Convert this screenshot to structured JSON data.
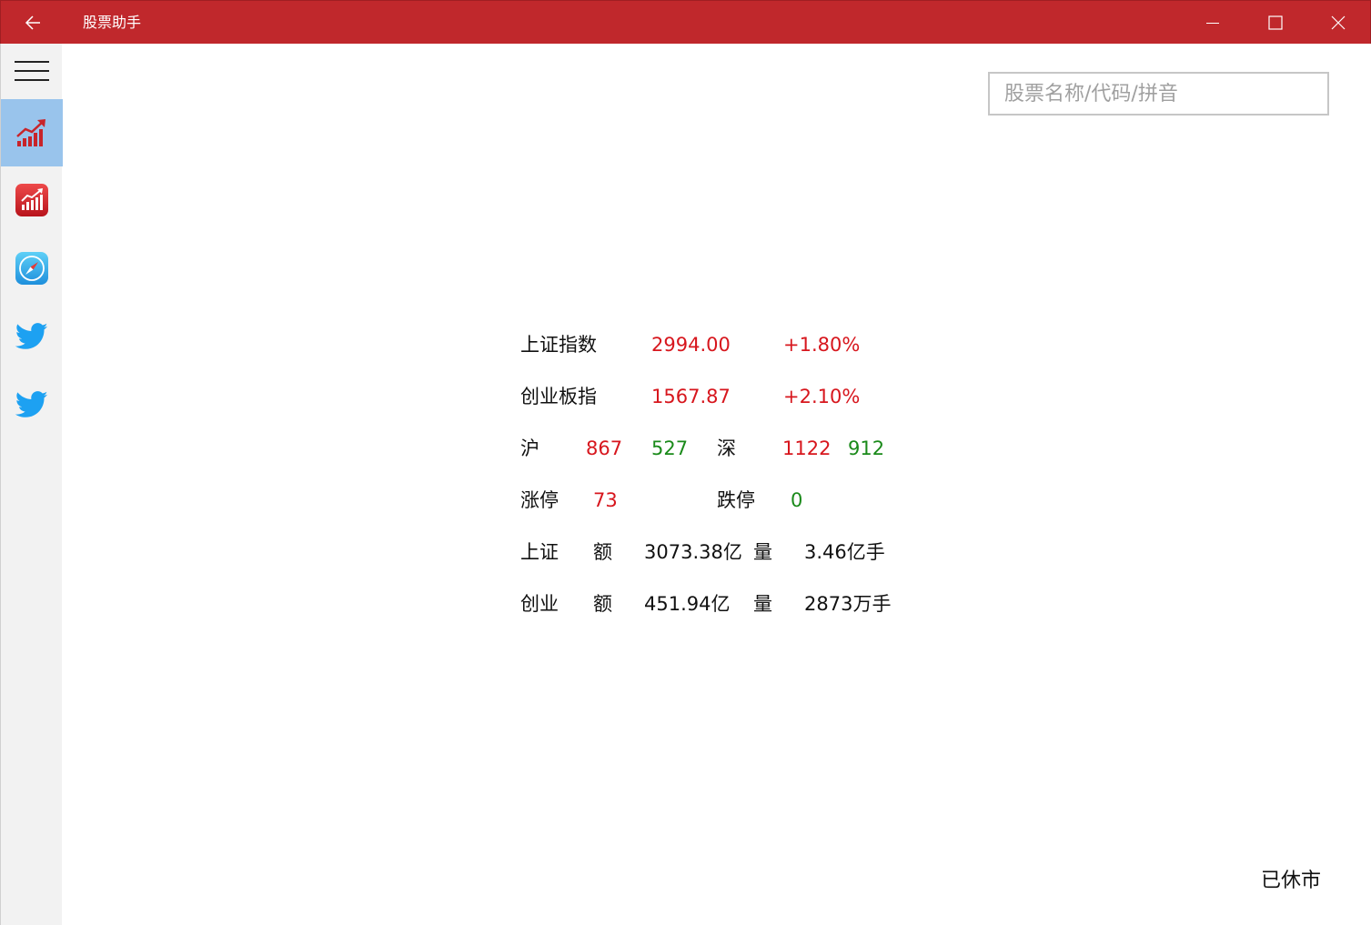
{
  "window": {
    "title": "股票助手",
    "back_icon": "arrow-left-icon",
    "minimize_icon": "minimize-icon",
    "maximize_icon": "maximize-icon",
    "close_icon": "close-icon",
    "bar_color": "#c0282c"
  },
  "sidebar": {
    "menu_icon": "hamburger-menu-icon",
    "items": [
      {
        "icon": "chart-trend-icon",
        "selected": true
      },
      {
        "icon": "chart-app-icon",
        "selected": false
      },
      {
        "icon": "compass-icon",
        "selected": false
      },
      {
        "icon": "twitter-bird-icon",
        "selected": false
      },
      {
        "icon": "twitter-bird-icon",
        "selected": false
      }
    ],
    "selected_color": "#99c4ec"
  },
  "search": {
    "placeholder": "股票名称/代码/拼音",
    "value": ""
  },
  "market": {
    "sh_index": {
      "label": "上证指数",
      "value": "2994.00",
      "change": "+1.80%"
    },
    "cy_index": {
      "label": "创业板指",
      "value": "1567.87",
      "change": "+2.10%"
    },
    "breadth": {
      "sh_label": "沪",
      "sh_up": "867",
      "sh_down": "527",
      "sz_label": "深",
      "sz_up": "1122",
      "sz_down": "912"
    },
    "limits": {
      "up_label": "涨停",
      "up_count": "73",
      "down_label": "跌停",
      "down_count": "0"
    },
    "sh_turnover": {
      "label": "上证",
      "amount_label": "额",
      "amount": "3073.38亿",
      "volume_label": "量",
      "volume": "3.46亿手"
    },
    "cy_turnover": {
      "label": "创业",
      "amount_label": "额",
      "amount": "451.94亿",
      "volume_label": "量",
      "volume": "2873万手"
    },
    "up_color": "#d7161d",
    "down_color": "#1a8a1a"
  },
  "status": {
    "text": "已休市"
  }
}
